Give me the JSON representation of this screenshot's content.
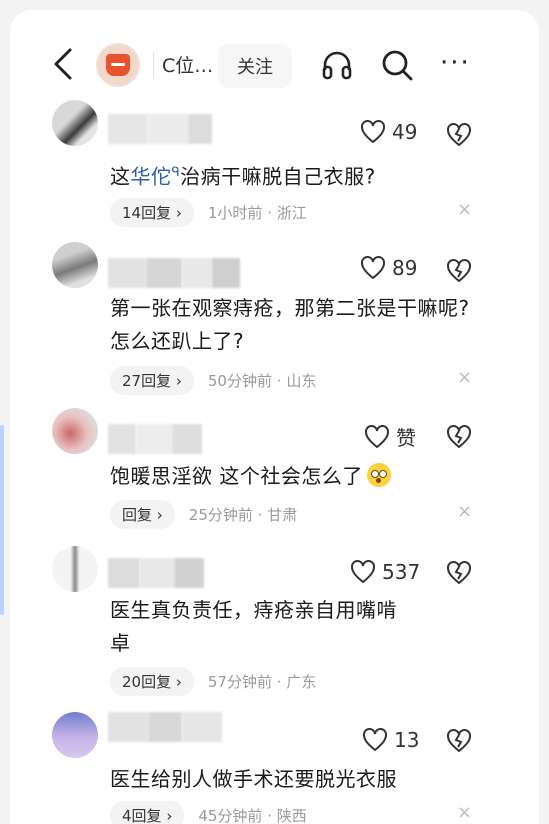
{
  "header": {
    "account_name": "C位…",
    "follow_label": "关注"
  },
  "comments": [
    {
      "text_parts": [
        "这",
        "华佗",
        "ᑫ",
        "治病干嘛脱自己衣服?"
      ],
      "likes": "49",
      "reply_label": "14回复",
      "time": "1小时前",
      "location": "浙江"
    },
    {
      "text": "第一张在观察痔疮，那第二张是干嘛呢? 怎么还趴上了?",
      "likes": "89",
      "reply_label": "27回复",
      "time": "50分钟前",
      "location": "山东"
    },
    {
      "text": "饱暖思淫欲 这个社会怎么了",
      "likes": "赞",
      "reply_label": "回复",
      "time": "25分钟前",
      "location": "甘肃"
    },
    {
      "text": "医生真负责任，痔疮亲自用嘴啃",
      "text_extra": "卓",
      "likes": "537",
      "reply_label": "20回复",
      "time": "57分钟前",
      "location": "广东"
    },
    {
      "text": "医生给别人做手术还要脱光衣服",
      "likes": "13",
      "reply_label": "4回复",
      "time": "45分钟前",
      "location": "陕西"
    }
  ],
  "icons": {
    "back": "chevron-left-icon",
    "listen": "headphones-icon",
    "search": "search-icon",
    "more": "more-icon",
    "like": "heart-icon",
    "dislike": "broken-heart-icon",
    "close": "close-icon"
  },
  "colors": {
    "link_blue": "#2a5db0",
    "meta_gray": "#9a9a9a"
  },
  "separators": {
    "dot": "·",
    "chevron": "›",
    "close": "×",
    "more": "···"
  }
}
